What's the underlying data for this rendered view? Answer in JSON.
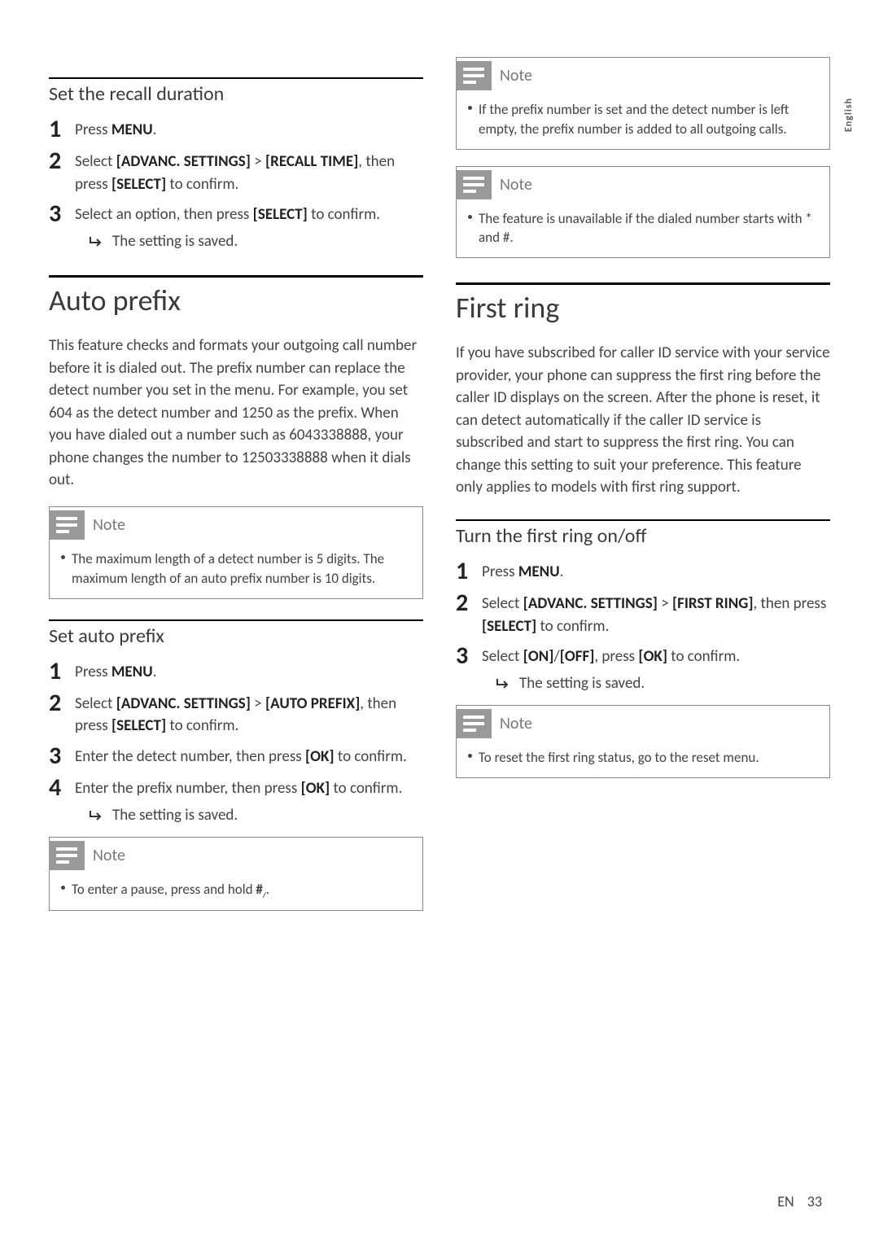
{
  "sideTab": "English",
  "left": {
    "recall": {
      "title": "Set the recall duration",
      "steps": [
        {
          "n": "1",
          "pre": "Press ",
          "b1": "MENU",
          "post": "."
        },
        {
          "n": "2",
          "pre": "Select ",
          "b1": "[ADVANC. SETTINGS]",
          "mid": " > ",
          "b2": "[RECALL TIME]",
          "mid2": ", then press ",
          "b3": "[SELECT]",
          "post": " to confirm."
        },
        {
          "n": "3",
          "pre": "Select an option, then press ",
          "b1": "[SELECT]",
          "post": " to confirm."
        }
      ],
      "result": "The setting is saved."
    },
    "autoPrefix": {
      "title": "Auto prefix",
      "desc": "This feature checks and formats your outgoing call number before it is dialed out. The prefix number can replace the detect number you set in the menu. For example, you set 604 as the detect number and 1250 as the prefix. When you have dialed out a number such as 6043338888, your phone changes the number to 12503338888 when it dials out.",
      "note1Label": "Note",
      "note1": "The maximum length of a detect number is 5 digits. The maximum length of an auto prefix number is 10 digits.",
      "subTitle": "Set auto prefix",
      "steps": [
        {
          "n": "1",
          "pre": "Press ",
          "b1": "MENU",
          "post": "."
        },
        {
          "n": "2",
          "pre": "Select ",
          "b1": "[ADVANC. SETTINGS]",
          "mid": " > ",
          "b2": "[AUTO PREFIX]",
          "mid2": ", then press ",
          "b3": "[SELECT]",
          "post": " to confirm."
        },
        {
          "n": "3",
          "pre": "Enter the detect number, then press ",
          "b1": "[OK]",
          "post": " to confirm."
        },
        {
          "n": "4",
          "pre": "Enter the prefix number, then press ",
          "b1": "[OK]",
          "post": " to confirm."
        }
      ],
      "result": "The setting is saved.",
      "note2Label": "Note",
      "note2Pre": "To enter a pause, press and hold ",
      "note2Post": "."
    }
  },
  "right": {
    "noteALabel": "Note",
    "noteA": "If the prefix number is set and the detect number is left empty, the prefix number is added to all outgoing calls.",
    "noteBLabel": "Note",
    "noteB": "The feature is unavailable if the dialed number starts with * and #.",
    "firstRing": {
      "title": "First ring",
      "desc": "If you have subscribed for caller ID service with your service provider, your phone can suppress the first ring before the caller ID displays on the screen. After the phone is reset, it can detect automatically if the caller ID service is subscribed and start to suppress the first ring. You can change this setting to suit your preference. This feature only applies to models with first ring support.",
      "subTitle": "Turn the first ring on/off",
      "steps": [
        {
          "n": "1",
          "pre": "Press ",
          "b1": "MENU",
          "post": "."
        },
        {
          "n": "2",
          "pre": "Select ",
          "b1": "[ADVANC. SETTINGS]",
          "mid": " > ",
          "b2": "[FIRST RING]",
          "mid2": ", then press ",
          "b3": "[SELECT]",
          "post": " to confirm."
        },
        {
          "n": "3",
          "pre": "Select ",
          "b1": "[ON]",
          "mid": "/",
          "b2": "[OFF]",
          "mid2": ", press ",
          "b3": "[OK]",
          "post": " to confirm."
        }
      ],
      "result": "The setting is saved.",
      "noteCLabel": "Note",
      "noteC": "To reset the first ring status, go to the reset menu."
    }
  },
  "footer": {
    "lang": "EN",
    "page": "33"
  }
}
